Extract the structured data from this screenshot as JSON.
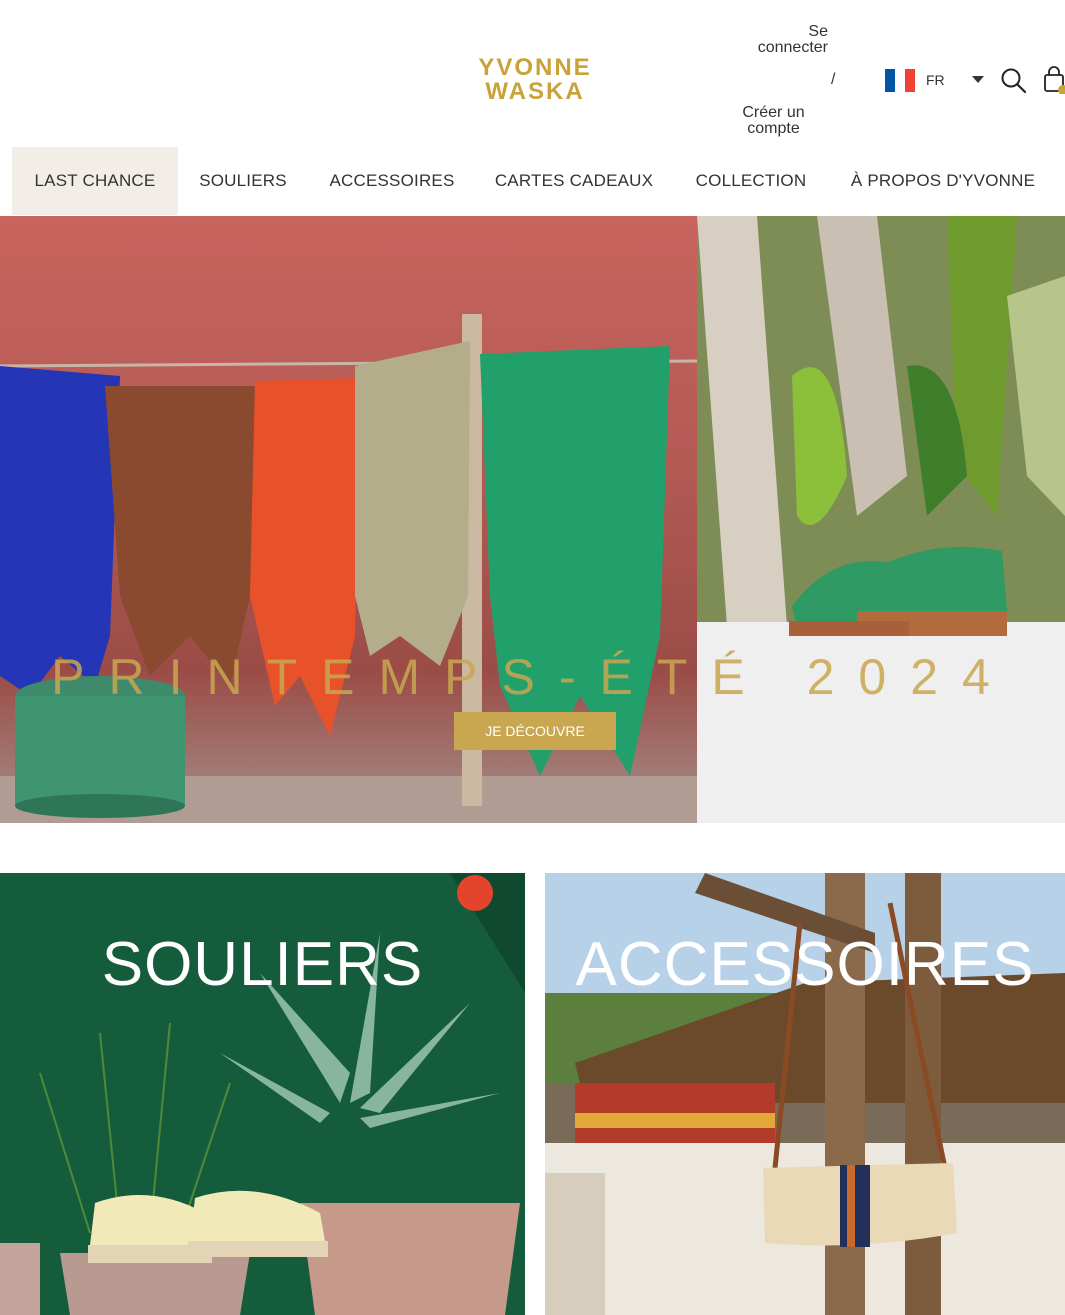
{
  "brand": {
    "line1": "YVONNE",
    "line2": "WASKA",
    "color": "#c9a23a"
  },
  "account": {
    "login": "Se connecter",
    "separator": "/",
    "signup": "Créer un compte"
  },
  "language": {
    "code": "FR",
    "flag_icon": "france-flag-icon",
    "colors": [
      "#0055a4",
      "#ffffff",
      "#ef4135"
    ]
  },
  "icons": {
    "search": "search-icon",
    "cart": "shopping-bag-icon",
    "dropdown": "chevron-down-icon"
  },
  "nav": [
    {
      "label": "LAST CHANCE"
    },
    {
      "label": "SOULIERS"
    },
    {
      "label": "ACCESSOIRES"
    },
    {
      "label": "CARTES CADEAUX"
    },
    {
      "label": "COLLECTION"
    },
    {
      "label": "À PROPOS D'YVONNE"
    }
  ],
  "hero": {
    "title": "PRINTEMPS-ÉTÉ 2024",
    "button": "JE DÉCOUVRE",
    "accent": "#c9a750"
  },
  "categories": [
    {
      "title": "SOULIERS"
    },
    {
      "title": "ACCESSOIRES"
    }
  ]
}
